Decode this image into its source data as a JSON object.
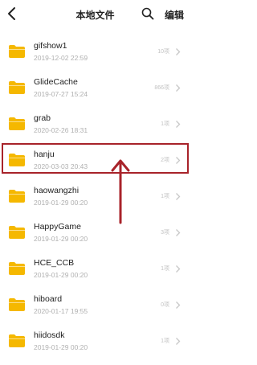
{
  "header": {
    "title": "本地文件",
    "edit_label": "编辑"
  },
  "folders": [
    {
      "name": "gifshow1",
      "date": "2019-12-02 22:59",
      "count": "10项"
    },
    {
      "name": "GlideCache",
      "date": "2019-07-27 15:24",
      "count": "866项"
    },
    {
      "name": "grab",
      "date": "2020-02-26 18:31",
      "count": "1项"
    },
    {
      "name": "hanju",
      "date": "2020-03-03 20:43",
      "count": "2项"
    },
    {
      "name": "haowangzhi",
      "date": "2019-01-29 00:20",
      "count": "1项"
    },
    {
      "name": "HappyGame",
      "date": "2019-01-29 00:20",
      "count": "3项"
    },
    {
      "name": "HCE_CCB",
      "date": "2019-01-29 00:20",
      "count": "1项"
    },
    {
      "name": "hiboard",
      "date": "2020-01-17 19:55",
      "count": "0项"
    },
    {
      "name": "hiidosdk",
      "date": "2019-01-29 00:20",
      "count": "1项"
    }
  ],
  "colors": {
    "folder": "#f5b800",
    "highlight": "#a8232a",
    "secondary_text": "#b0b0b0"
  },
  "icons": {
    "back": "chevron-left-icon",
    "search": "search-icon",
    "folder": "folder-icon",
    "row_chevron": "chevron-right-icon"
  }
}
